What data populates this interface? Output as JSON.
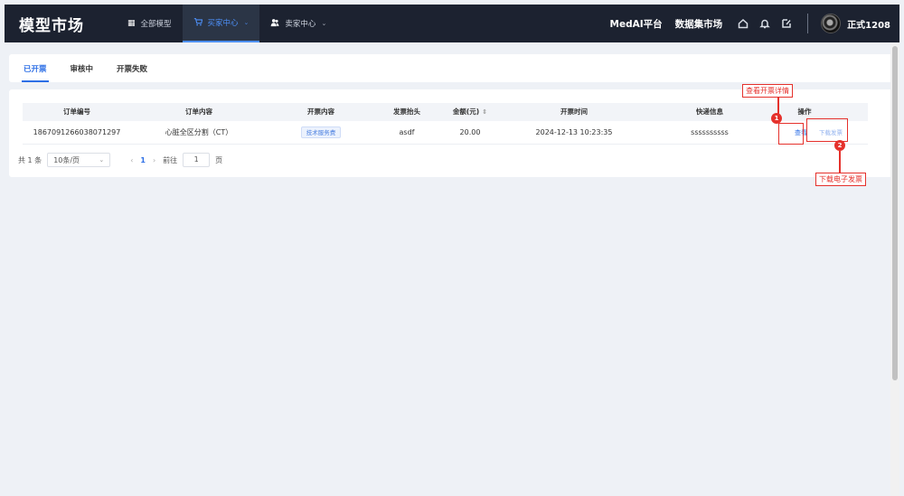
{
  "app": {
    "logo": "模型市场"
  },
  "nav": {
    "items": [
      {
        "label": "全部模型",
        "icon": "grid-icon"
      },
      {
        "label": "买家中心",
        "icon": "cart-icon",
        "active": true
      },
      {
        "label": "卖家中心",
        "icon": "users-icon"
      }
    ],
    "right_links": [
      "MedAI平台",
      "数据集市场"
    ],
    "username": "正式1208"
  },
  "tabs": [
    {
      "label": "已开票",
      "active": true
    },
    {
      "label": "审核中"
    },
    {
      "label": "开票失败"
    }
  ],
  "table": {
    "headers": [
      "订单编号",
      "订单内容",
      "开票内容",
      "发票抬头",
      "金额(元)",
      "开票时间",
      "快递信息",
      "操作"
    ],
    "rows": [
      {
        "order_no": "1867091266038071297",
        "order_content": "心脏全区分割（CT）",
        "invoice_content": "技术服务费",
        "invoice_title": "asdf",
        "amount": "20.00",
        "invoice_time": "2024-12-13 10:23:35",
        "express": "ssssssssss",
        "action_view": "查看",
        "action_download": "下载发票"
      }
    ]
  },
  "pagination": {
    "total": "共 1 条",
    "page_size": "10条/页",
    "current_page": "1",
    "goto_label": "前往",
    "goto_value": "1",
    "page_unit": "页"
  },
  "annotations": [
    {
      "number": "1",
      "label": "查看开票详情"
    },
    {
      "number": "2",
      "label": "下载电子发票"
    }
  ],
  "colors": {
    "accent": "#2d6fe6",
    "annotation": "#e5312c",
    "topbar": "#1c2230"
  }
}
